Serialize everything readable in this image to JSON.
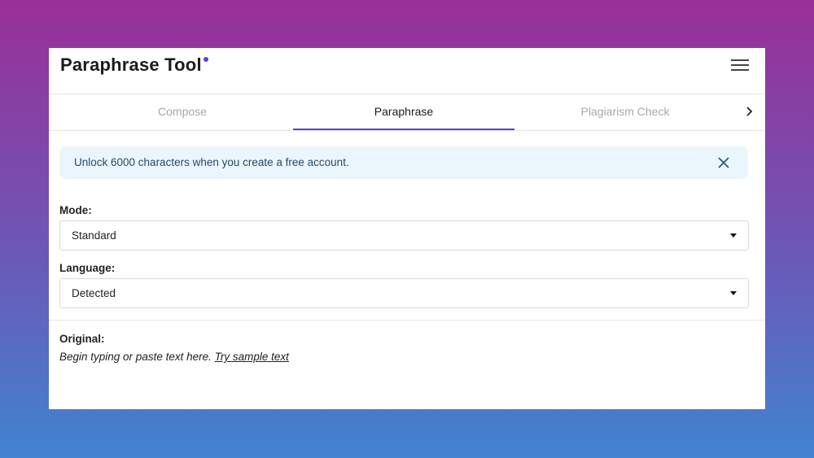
{
  "header": {
    "title": "Paraphrase Tool",
    "accent_color": "#5b3fe6",
    "menu_icon": "hamburger-menu-icon"
  },
  "tabs": [
    {
      "label": "Compose",
      "active": false
    },
    {
      "label": "Paraphrase",
      "active": true
    },
    {
      "label": "Plagiarism Check",
      "active": false
    }
  ],
  "tabs_next_icon": "chevron-right-icon",
  "banner": {
    "text": "Unlock 6000 characters when you create a free account.",
    "close_icon": "close-icon",
    "background": "#eaf6fc"
  },
  "mode": {
    "label": "Mode:",
    "value": "Standard"
  },
  "language": {
    "label": "Language:",
    "value": "Detected"
  },
  "original": {
    "label": "Original:",
    "placeholder": "Begin typing or paste text here.",
    "sample_link": "Try sample text"
  }
}
